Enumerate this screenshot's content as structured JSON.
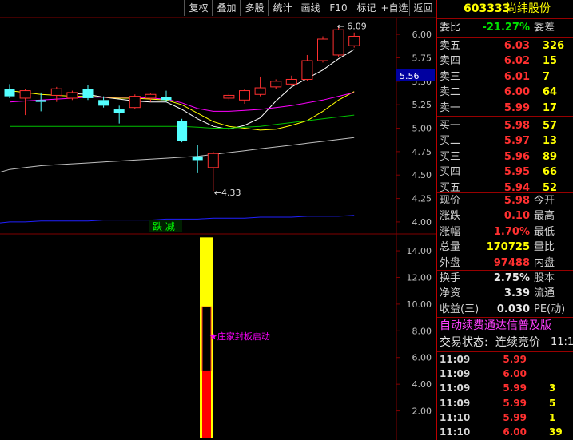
{
  "toolbar": {
    "buttons": [
      "复权",
      "叠加",
      "多股",
      "统计",
      "画线",
      "F10",
      "标记",
      "+自选",
      "返回"
    ]
  },
  "stock": {
    "code": "603333",
    "name": "尚纬股份",
    "commission_ratio_label": "委比",
    "commission_ratio": "-21.27%",
    "commission_diff_label": "委差"
  },
  "order_book": [
    {
      "label": "卖五",
      "price": "6.03",
      "volume": "326"
    },
    {
      "label": "卖四",
      "price": "6.02",
      "volume": "15"
    },
    {
      "label": "卖三",
      "price": "6.01",
      "volume": "7"
    },
    {
      "label": "卖二",
      "price": "6.00",
      "volume": "64"
    },
    {
      "label": "卖一",
      "price": "5.99",
      "volume": "17"
    },
    {
      "label": "买一",
      "price": "5.98",
      "volume": "57"
    },
    {
      "label": "买二",
      "price": "5.97",
      "volume": "13"
    },
    {
      "label": "买三",
      "price": "5.96",
      "volume": "89"
    },
    {
      "label": "买四",
      "price": "5.95",
      "volume": "66"
    },
    {
      "label": "买五",
      "price": "5.94",
      "volume": "52"
    }
  ],
  "stats": [
    {
      "label": "现价",
      "value": "5.98",
      "value_color": "#ff3030",
      "label2": "今开"
    },
    {
      "label": "涨跌",
      "value": "0.10",
      "value_color": "#ff3030",
      "label2": "最高"
    },
    {
      "label": "涨幅",
      "value": "1.70%",
      "value_color": "#ff3030",
      "label2": "最低"
    },
    {
      "label": "总量",
      "value": "170725",
      "value_color": "#ffff00",
      "label2": "量比"
    },
    {
      "label": "外盘",
      "value": "97488",
      "value_color": "#ff3030",
      "label2": "内盘"
    }
  ],
  "fundamentals": [
    {
      "label": "换手",
      "value": "2.75%",
      "label2": "股本"
    },
    {
      "label": "净资",
      "value": "3.39",
      "label2": "流通"
    },
    {
      "label": "收益(三)",
      "value": "0.030",
      "label2": "PE(动)"
    }
  ],
  "banner": "自动续费通达信普及版",
  "trade_status_label": "交易状态:",
  "trade_status_value": "连续竞价",
  "trade_status_time": "11:1",
  "ticks": [
    {
      "time": "11:09",
      "price": "5.99",
      "volume": ""
    },
    {
      "time": "11:09",
      "price": "6.00",
      "volume": ""
    },
    {
      "time": "11:09",
      "price": "5.99",
      "volume": "3"
    },
    {
      "time": "11:09",
      "price": "5.99",
      "volume": "5"
    },
    {
      "time": "11:10",
      "price": "5.99",
      "volume": "1"
    },
    {
      "time": "11:10",
      "price": "6.00",
      "volume": "39"
    }
  ],
  "price_axis": {
    "ticks": [
      "6.00",
      "5.75",
      "5.50",
      "5.25",
      "5.00",
      "4.75",
      "4.50",
      "4.25",
      "4.00"
    ],
    "current_price_tag": "5.56",
    "high_label": "6.09",
    "low_label": "4.33"
  },
  "indicator_axis": {
    "ticks": [
      "14.00",
      "12.00",
      "10.00",
      "8.00",
      "6.00",
      "4.00",
      "2.00"
    ]
  },
  "divider_label": "跌 减",
  "indicator_annotation": "庄家封板启动",
  "colors": {
    "up": "#ff3030",
    "down": "#54ffff",
    "ma5": "#ffffff",
    "ma10": "#ffff00",
    "ma20": "#ff00ff",
    "ma60": "#00c000",
    "ma120": "#c0c0c0",
    "ma250": "#2020ff",
    "grid": "#800000",
    "accent": "#ff00ff"
  },
  "chart_data": {
    "type": "candlestick",
    "candles": [
      {
        "o": 5.42,
        "h": 5.47,
        "l": 5.32,
        "c": 5.34
      },
      {
        "o": 5.32,
        "h": 5.42,
        "l": 5.14,
        "c": 5.4
      },
      {
        "o": 5.3,
        "h": 5.38,
        "l": 5.18,
        "c": 5.28
      },
      {
        "o": 5.35,
        "h": 5.44,
        "l": 5.28,
        "c": 5.42
      },
      {
        "o": 5.32,
        "h": 5.4,
        "l": 5.3,
        "c": 5.38
      },
      {
        "o": 5.42,
        "h": 5.46,
        "l": 5.3,
        "c": 5.32
      },
      {
        "o": 5.3,
        "h": 5.34,
        "l": 5.22,
        "c": 5.24
      },
      {
        "o": 5.2,
        "h": 5.24,
        "l": 5.05,
        "c": 5.16
      },
      {
        "o": 5.22,
        "h": 5.36,
        "l": 5.2,
        "c": 5.34
      },
      {
        "o": 5.32,
        "h": 5.37,
        "l": 5.28,
        "c": 5.36
      },
      {
        "o": 5.33,
        "h": 5.4,
        "l": 5.28,
        "c": 5.3
      },
      {
        "o": 5.08,
        "h": 5.1,
        "l": 4.85,
        "c": 4.86
      },
      {
        "o": 4.7,
        "h": 4.82,
        "l": 4.52,
        "c": 4.66
      },
      {
        "o": 4.58,
        "h": 4.75,
        "l": 4.33,
        "c": 4.73
      },
      {
        "o": 5.32,
        "h": 5.37,
        "l": 5.3,
        "c": 5.35
      },
      {
        "o": 5.3,
        "h": 5.42,
        "l": 5.26,
        "c": 5.4
      },
      {
        "o": 5.36,
        "h": 5.55,
        "l": 5.34,
        "c": 5.43
      },
      {
        "o": 5.44,
        "h": 5.52,
        "l": 5.42,
        "c": 5.5
      },
      {
        "o": 5.47,
        "h": 5.56,
        "l": 5.45,
        "c": 5.52
      },
      {
        "o": 5.52,
        "h": 5.78,
        "l": 5.5,
        "c": 5.72
      },
      {
        "o": 5.72,
        "h": 5.98,
        "l": 5.7,
        "c": 5.95
      },
      {
        "o": 5.78,
        "h": 6.09,
        "l": 5.76,
        "c": 6.05
      },
      {
        "o": 5.88,
        "h": 6.02,
        "l": 5.86,
        "c": 5.98
      }
    ],
    "ma": [
      {
        "name": "MA5",
        "color": "#ffffff",
        "values": [
          null,
          null,
          null,
          null,
          5.37,
          5.36,
          5.33,
          5.31,
          5.29,
          5.28,
          5.28,
          5.2,
          5.1,
          5.02,
          4.99,
          5.03,
          5.11,
          5.29,
          5.44,
          5.53,
          5.62,
          5.74,
          5.84
        ]
      },
      {
        "name": "MA10",
        "color": "#ffff00",
        "values": [
          5.4,
          5.38,
          5.36,
          5.35,
          5.34,
          5.34,
          5.33,
          5.32,
          5.32,
          5.31,
          5.3,
          5.25,
          5.16,
          5.07,
          5.02,
          5.0,
          4.98,
          4.99,
          5.03,
          5.08,
          5.18,
          5.3,
          5.39
        ]
      },
      {
        "name": "MA20",
        "color": "#ff00ff",
        "values": [
          5.28,
          5.29,
          5.3,
          5.31,
          5.32,
          5.33,
          5.33,
          5.33,
          5.33,
          5.32,
          5.31,
          5.27,
          5.21,
          5.18,
          5.18,
          5.19,
          5.2,
          5.22,
          5.24,
          5.27,
          5.3,
          5.34,
          5.38
        ]
      },
      {
        "name": "MA60",
        "color": "#00c000",
        "values": [
          5.02,
          5.02,
          5.02,
          5.02,
          5.02,
          5.02,
          5.02,
          5.02,
          5.02,
          5.02,
          5.02,
          5.02,
          5.01,
          5.0,
          5.0,
          5.01,
          5.02,
          5.04,
          5.06,
          5.08,
          5.1,
          5.12,
          5.14
        ]
      },
      {
        "name": "MA120",
        "color": "#c0c0c0",
        "values": [
          4.56,
          4.58,
          4.6,
          4.61,
          4.62,
          4.63,
          4.64,
          4.65,
          4.66,
          4.67,
          4.68,
          4.69,
          4.7,
          4.72,
          4.74,
          4.76,
          4.78,
          4.8,
          4.82,
          4.84,
          4.86,
          4.88,
          4.9
        ]
      },
      {
        "name": "MA250",
        "color": "#2020ff",
        "values": [
          4.0,
          4.0,
          4.01,
          4.01,
          4.01,
          4.01,
          4.02,
          4.02,
          4.02,
          4.02,
          4.03,
          4.03,
          4.03,
          4.04,
          4.04,
          4.04,
          4.05,
          4.05,
          4.05,
          4.06,
          4.06,
          4.06,
          4.07
        ]
      }
    ],
    "ylim": [
      3.88,
      6.18
    ],
    "indicator": {
      "ylim": [
        0,
        15.2
      ],
      "outer_top": 15.0,
      "inner_top": 9.8,
      "inner_red_top": 5.0
    }
  }
}
